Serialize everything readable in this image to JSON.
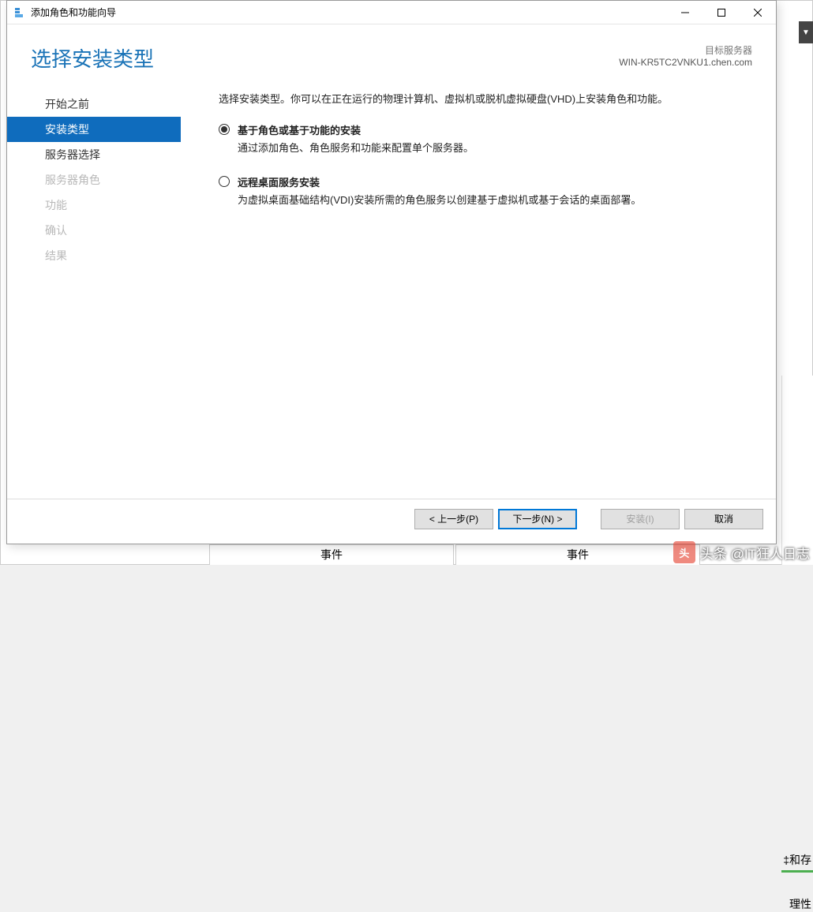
{
  "window": {
    "title": "添加角色和功能向导"
  },
  "header": {
    "page_title": "选择安装类型",
    "target_label": "目标服务器",
    "target_name": "WIN-KR5TC2VNKU1.chen.com"
  },
  "sidebar": {
    "items": [
      {
        "label": "开始之前",
        "state": "normal"
      },
      {
        "label": "安装类型",
        "state": "selected"
      },
      {
        "label": "服务器选择",
        "state": "normal"
      },
      {
        "label": "服务器角色",
        "state": "disabled"
      },
      {
        "label": "功能",
        "state": "disabled"
      },
      {
        "label": "确认",
        "state": "disabled"
      },
      {
        "label": "结果",
        "state": "disabled"
      }
    ]
  },
  "content": {
    "intro": "选择安装类型。你可以在正在运行的物理计算机、虚拟机或脱机虚拟硬盘(VHD)上安装角色和功能。",
    "options": [
      {
        "title": "基于角色或基于功能的安装",
        "desc": "通过添加角色、角色服务和功能来配置单个服务器。",
        "checked": true
      },
      {
        "title": "远程桌面服务安装",
        "desc": "为虚拟桌面基础结构(VDI)安装所需的角色服务以创建基于虚拟机或基于会话的桌面部署。",
        "checked": false
      }
    ]
  },
  "footer": {
    "prev": "< 上一步(P)",
    "next": "下一步(N) >",
    "install": "安装(I)",
    "cancel": "取消"
  },
  "background": {
    "tab1": "事件",
    "tab2": "事件",
    "snip1": "‡和存",
    "snip2": "理性"
  },
  "watermark": "头条 @IT狂人日志"
}
